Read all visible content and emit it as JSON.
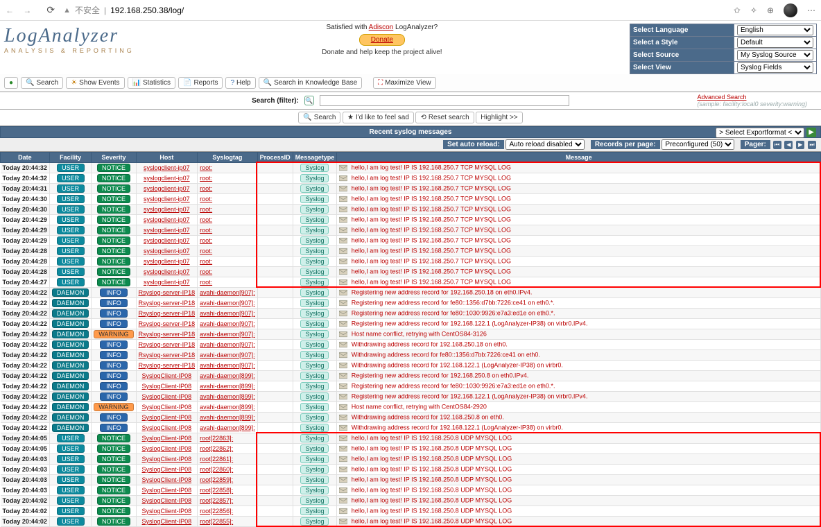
{
  "browser": {
    "insecure_label": "不安全",
    "url": "192.168.250.38/log/"
  },
  "logo": {
    "title": "LogAnalyzer",
    "subtitle": "ANALYSIS & REPORTING"
  },
  "header_center": {
    "satisfied_prefix": "Satisfied with ",
    "brand_link": "Adiscon",
    "satisfied_suffix": " LogAnalyzer?",
    "donate": "Donate",
    "donate_note": "Donate and help keep the project alive!"
  },
  "selectors": {
    "language": {
      "label": "Select Language",
      "value": "English"
    },
    "style": {
      "label": "Select a Style",
      "value": "Default"
    },
    "source": {
      "label": "Select Source",
      "value": "My Syslog Source"
    },
    "view": {
      "label": "Select View",
      "value": "Syslog Fields"
    }
  },
  "toolbar": {
    "search": "Search",
    "show_events": "Show Events",
    "statistics": "Statistics",
    "reports": "Reports",
    "help": "Help",
    "kb": "Search in Knowledge Base",
    "max_view": "Maximize View"
  },
  "search": {
    "label": "Search (filter):",
    "placeholder": "",
    "btn_search": "Search",
    "btn_feelsad": "I'd like to feel sad",
    "btn_reset": "Reset search",
    "btn_highlight": "Highlight >>",
    "advanced": "Advanced Search",
    "sample": "(sample: facility:local0 severity:warning)"
  },
  "section_title": "Recent syslog messages",
  "export_label": "> Select Exportformat <",
  "settings": {
    "autoreload_label": "Set auto reload:",
    "autoreload_value": "Auto reload disabled",
    "records_label": "Records per page:",
    "records_value": "Preconfigured (50)",
    "pager_label": "Pager:"
  },
  "columns": {
    "date": "Date",
    "facility": "Facility",
    "severity": "Severity",
    "host": "Host",
    "syslogtag": "Syslogtag",
    "processid": "ProcessID",
    "messagetype": "Messagetype",
    "message": "Message"
  },
  "rows": [
    {
      "date": "Today 20:44:32",
      "fac": "USER",
      "sev": "NOTICE",
      "host": "syslogclient-ip07",
      "tag": "root:",
      "mt": "Syslog",
      "msg_pre": "hello,I am log test! IP IS ",
      "ip": "192.168.250.7",
      "msg_post": " TCP MYSQL LOG"
    },
    {
      "date": "Today 20:44:32",
      "fac": "USER",
      "sev": "NOTICE",
      "host": "syslogclient-ip07",
      "tag": "root:",
      "mt": "Syslog",
      "msg_pre": "hello,I am log test! IP IS ",
      "ip": "192.168.250.7",
      "msg_post": " TCP MYSQL LOG"
    },
    {
      "date": "Today 20:44:31",
      "fac": "USER",
      "sev": "NOTICE",
      "host": "syslogclient-ip07",
      "tag": "root:",
      "mt": "Syslog",
      "msg_pre": "hello,I am log test! IP IS ",
      "ip": "192.168.250.7",
      "msg_post": " TCP MYSQL LOG"
    },
    {
      "date": "Today 20:44:30",
      "fac": "USER",
      "sev": "NOTICE",
      "host": "syslogclient-ip07",
      "tag": "root:",
      "mt": "Syslog",
      "msg_pre": "hello,I am log test! IP IS ",
      "ip": "192.168.250.7",
      "msg_post": " TCP MYSQL LOG"
    },
    {
      "date": "Today 20:44:30",
      "fac": "USER",
      "sev": "NOTICE",
      "host": "syslogclient-ip07",
      "tag": "root:",
      "mt": "Syslog",
      "msg_pre": "hello,I am log test! IP IS ",
      "ip": "192.168.250.7",
      "msg_post": " TCP MYSQL LOG"
    },
    {
      "date": "Today 20:44:29",
      "fac": "USER",
      "sev": "NOTICE",
      "host": "syslogclient-ip07",
      "tag": "root:",
      "mt": "Syslog",
      "msg_pre": "hello,I am log test! IP IS ",
      "ip": "192.168.250.7",
      "msg_post": " TCP MYSQL LOG"
    },
    {
      "date": "Today 20:44:29",
      "fac": "USER",
      "sev": "NOTICE",
      "host": "syslogclient-ip07",
      "tag": "root:",
      "mt": "Syslog",
      "msg_pre": "hello,I am log test! IP IS ",
      "ip": "192.168.250.7",
      "msg_post": " TCP MYSQL LOG"
    },
    {
      "date": "Today 20:44:29",
      "fac": "USER",
      "sev": "NOTICE",
      "host": "syslogclient-ip07",
      "tag": "root:",
      "mt": "Syslog",
      "msg_pre": "hello,I am log test! IP IS ",
      "ip": "192.168.250.7",
      "msg_post": " TCP MYSQL LOG"
    },
    {
      "date": "Today 20:44:28",
      "fac": "USER",
      "sev": "NOTICE",
      "host": "syslogclient-ip07",
      "tag": "root:",
      "mt": "Syslog",
      "msg_pre": "hello,I am log test! IP IS ",
      "ip": "192.168.250.7",
      "msg_post": " TCP MYSQL LOG"
    },
    {
      "date": "Today 20:44:28",
      "fac": "USER",
      "sev": "NOTICE",
      "host": "syslogclient-ip07",
      "tag": "root:",
      "mt": "Syslog",
      "msg_pre": "hello,I am log test! IP IS ",
      "ip": "192.168.250.7",
      "msg_post": " TCP MYSQL LOG"
    },
    {
      "date": "Today 20:44:28",
      "fac": "USER",
      "sev": "NOTICE",
      "host": "syslogclient-ip07",
      "tag": "root:",
      "mt": "Syslog",
      "msg_pre": "hello,I am log test! IP IS ",
      "ip": "192.168.250.7",
      "msg_post": " TCP MYSQL LOG"
    },
    {
      "date": "Today 20:44:27",
      "fac": "USER",
      "sev": "NOTICE",
      "host": "syslogclient-ip07",
      "tag": "root:",
      "mt": "Syslog",
      "msg_pre": "hello,I am log test! IP IS ",
      "ip": "192.168.250.7",
      "msg_post": " TCP MYSQL LOG"
    },
    {
      "date": "Today 20:44:22",
      "fac": "DAEMON",
      "sev": "INFO",
      "host": "Rsyslog-server-IP18",
      "tag": "avahi-daemon[907]:",
      "mt": "Syslog",
      "msg_pre": "Registering new address record for ",
      "ip": "192.168.250.18",
      "msg_post": " on eth0.IPv4."
    },
    {
      "date": "Today 20:44:22",
      "fac": "DAEMON",
      "sev": "INFO",
      "host": "Rsyslog-server-IP18",
      "tag": "avahi-daemon[907]:",
      "mt": "Syslog",
      "msg_pre": "Registering new address record for fe80::1356:d7bb:7226:ce41 on eth0.*.",
      "ip": "",
      "msg_post": ""
    },
    {
      "date": "Today 20:44:22",
      "fac": "DAEMON",
      "sev": "INFO",
      "host": "Rsyslog-server-IP18",
      "tag": "avahi-daemon[907]:",
      "mt": "Syslog",
      "msg_pre": "Registering new address record for fe80::1030:9926:e7a3:ed1e on eth0.*.",
      "ip": "",
      "msg_post": ""
    },
    {
      "date": "Today 20:44:22",
      "fac": "DAEMON",
      "sev": "INFO",
      "host": "Rsyslog-server-IP18",
      "tag": "avahi-daemon[907]:",
      "mt": "Syslog",
      "msg_pre": "Registering new address record for ",
      "ip": "192.168.122.1",
      "msg_post": " (LogAnalyzer-IP38) on virbr0.IPv4."
    },
    {
      "date": "Today 20:44:22",
      "fac": "DAEMON",
      "sev": "WARNING",
      "host": "Rsyslog-server-IP18",
      "tag": "avahi-daemon[907]:",
      "mt": "Syslog",
      "msg_pre": "Host name conflict, retrying with CentOS84-3126",
      "ip": "",
      "msg_post": ""
    },
    {
      "date": "Today 20:44:22",
      "fac": "DAEMON",
      "sev": "INFO",
      "host": "Rsyslog-server-IP18",
      "tag": "avahi-daemon[907]:",
      "mt": "Syslog",
      "msg_pre": "Withdrawing address record for ",
      "ip": "192.168.250.18",
      "msg_post": " on eth0."
    },
    {
      "date": "Today 20:44:22",
      "fac": "DAEMON",
      "sev": "INFO",
      "host": "Rsyslog-server-IP18",
      "tag": "avahi-daemon[907]:",
      "mt": "Syslog",
      "msg_pre": "Withdrawing address record for fe80::1356:d7bb:7226:ce41 on eth0.",
      "ip": "",
      "msg_post": ""
    },
    {
      "date": "Today 20:44:22",
      "fac": "DAEMON",
      "sev": "INFO",
      "host": "Rsyslog-server-IP18",
      "tag": "avahi-daemon[907]:",
      "mt": "Syslog",
      "msg_pre": "Withdrawing address record for ",
      "ip": "192.168.122.1",
      "msg_post": " (LogAnalyzer-IP38) on virbr0."
    },
    {
      "date": "Today 20:44:22",
      "fac": "DAEMON",
      "sev": "INFO",
      "host": "SyslogClient-IP08",
      "tag": "avahi-daemon[899]:",
      "mt": "Syslog",
      "msg_pre": "Registering new address record for ",
      "ip": "192.168.250.8",
      "msg_post": " on eth0.IPv4."
    },
    {
      "date": "Today 20:44:22",
      "fac": "DAEMON",
      "sev": "INFO",
      "host": "SyslogClient-IP08",
      "tag": "avahi-daemon[899]:",
      "mt": "Syslog",
      "msg_pre": "Registering new address record for fe80::1030:9926:e7a3:ed1e on eth0.*.",
      "ip": "",
      "msg_post": ""
    },
    {
      "date": "Today 20:44:22",
      "fac": "DAEMON",
      "sev": "INFO",
      "host": "SyslogClient-IP08",
      "tag": "avahi-daemon[899]:",
      "mt": "Syslog",
      "msg_pre": "Registering new address record for ",
      "ip": "192.168.122.1",
      "msg_post": " (LogAnalyzer-IP38) on virbr0.IPv4."
    },
    {
      "date": "Today 20:44:22",
      "fac": "DAEMON",
      "sev": "WARNING",
      "host": "SyslogClient-IP08",
      "tag": "avahi-daemon[899]:",
      "mt": "Syslog",
      "msg_pre": "Host name conflict, retrying with CentOS84-2920",
      "ip": "",
      "msg_post": ""
    },
    {
      "date": "Today 20:44:22",
      "fac": "DAEMON",
      "sev": "INFO",
      "host": "SyslogClient-IP08",
      "tag": "avahi-daemon[899]:",
      "mt": "Syslog",
      "msg_pre": "Withdrawing address record for ",
      "ip": "192.168.250.8",
      "msg_post": " on eth0."
    },
    {
      "date": "Today 20:44:22",
      "fac": "DAEMON",
      "sev": "INFO",
      "host": "SyslogClient-IP08",
      "tag": "avahi-daemon[899]:",
      "mt": "Syslog",
      "msg_pre": "Withdrawing address record for ",
      "ip": "192.168.122.1",
      "msg_post": " (LogAnalyzer-IP38) on virbr0."
    },
    {
      "date": "Today 20:44:05",
      "fac": "USER",
      "sev": "NOTICE",
      "host": "SyslogClient-IP08",
      "tag": "root[22863]:",
      "mt": "Syslog",
      "msg_pre": "hello,I am log test! IP IS ",
      "ip": "192.168.250.8",
      "msg_post": " UDP MYSQL LOG"
    },
    {
      "date": "Today 20:44:05",
      "fac": "USER",
      "sev": "NOTICE",
      "host": "SyslogClient-IP08",
      "tag": "root[22862]:",
      "mt": "Syslog",
      "msg_pre": "hello,I am log test! IP IS ",
      "ip": "192.168.250.8",
      "msg_post": " UDP MYSQL LOG"
    },
    {
      "date": "Today 20:44:03",
      "fac": "USER",
      "sev": "NOTICE",
      "host": "SyslogClient-IP08",
      "tag": "root[22861]:",
      "mt": "Syslog",
      "msg_pre": "hello,I am log test! IP IS ",
      "ip": "192.168.250.8",
      "msg_post": " UDP MYSQL LOG"
    },
    {
      "date": "Today 20:44:03",
      "fac": "USER",
      "sev": "NOTICE",
      "host": "SyslogClient-IP08",
      "tag": "root[22860]:",
      "mt": "Syslog",
      "msg_pre": "hello,I am log test! IP IS ",
      "ip": "192.168.250.8",
      "msg_post": " UDP MYSQL LOG"
    },
    {
      "date": "Today 20:44:03",
      "fac": "USER",
      "sev": "NOTICE",
      "host": "SyslogClient-IP08",
      "tag": "root[22859]:",
      "mt": "Syslog",
      "msg_pre": "hello,I am log test! IP IS ",
      "ip": "192.168.250.8",
      "msg_post": " UDP MYSQL LOG"
    },
    {
      "date": "Today 20:44:03",
      "fac": "USER",
      "sev": "NOTICE",
      "host": "SyslogClient-IP08",
      "tag": "root[22858]:",
      "mt": "Syslog",
      "msg_pre": "hello,I am log test! IP IS ",
      "ip": "192.168.250.8",
      "msg_post": " UDP MYSQL LOG"
    },
    {
      "date": "Today 20:44:02",
      "fac": "USER",
      "sev": "NOTICE",
      "host": "SyslogClient-IP08",
      "tag": "root[22857]:",
      "mt": "Syslog",
      "msg_pre": "hello,I am log test! IP IS ",
      "ip": "192.168.250.8",
      "msg_post": " UDP MYSQL LOG"
    },
    {
      "date": "Today 20:44:02",
      "fac": "USER",
      "sev": "NOTICE",
      "host": "SyslogClient-IP08",
      "tag": "root[22856]:",
      "mt": "Syslog",
      "msg_pre": "hello,I am log test! IP IS ",
      "ip": "192.168.250.8",
      "msg_post": " UDP MYSQL LOG"
    },
    {
      "date": "Today 20:44:02",
      "fac": "USER",
      "sev": "NOTICE",
      "host": "SyslogClient-IP08",
      "tag": "root[22855]:",
      "mt": "Syslog",
      "msg_pre": "hello,I am log test! IP IS ",
      "ip": "192.168.250.8",
      "msg_post": " UDP MYSQL LOG"
    }
  ]
}
